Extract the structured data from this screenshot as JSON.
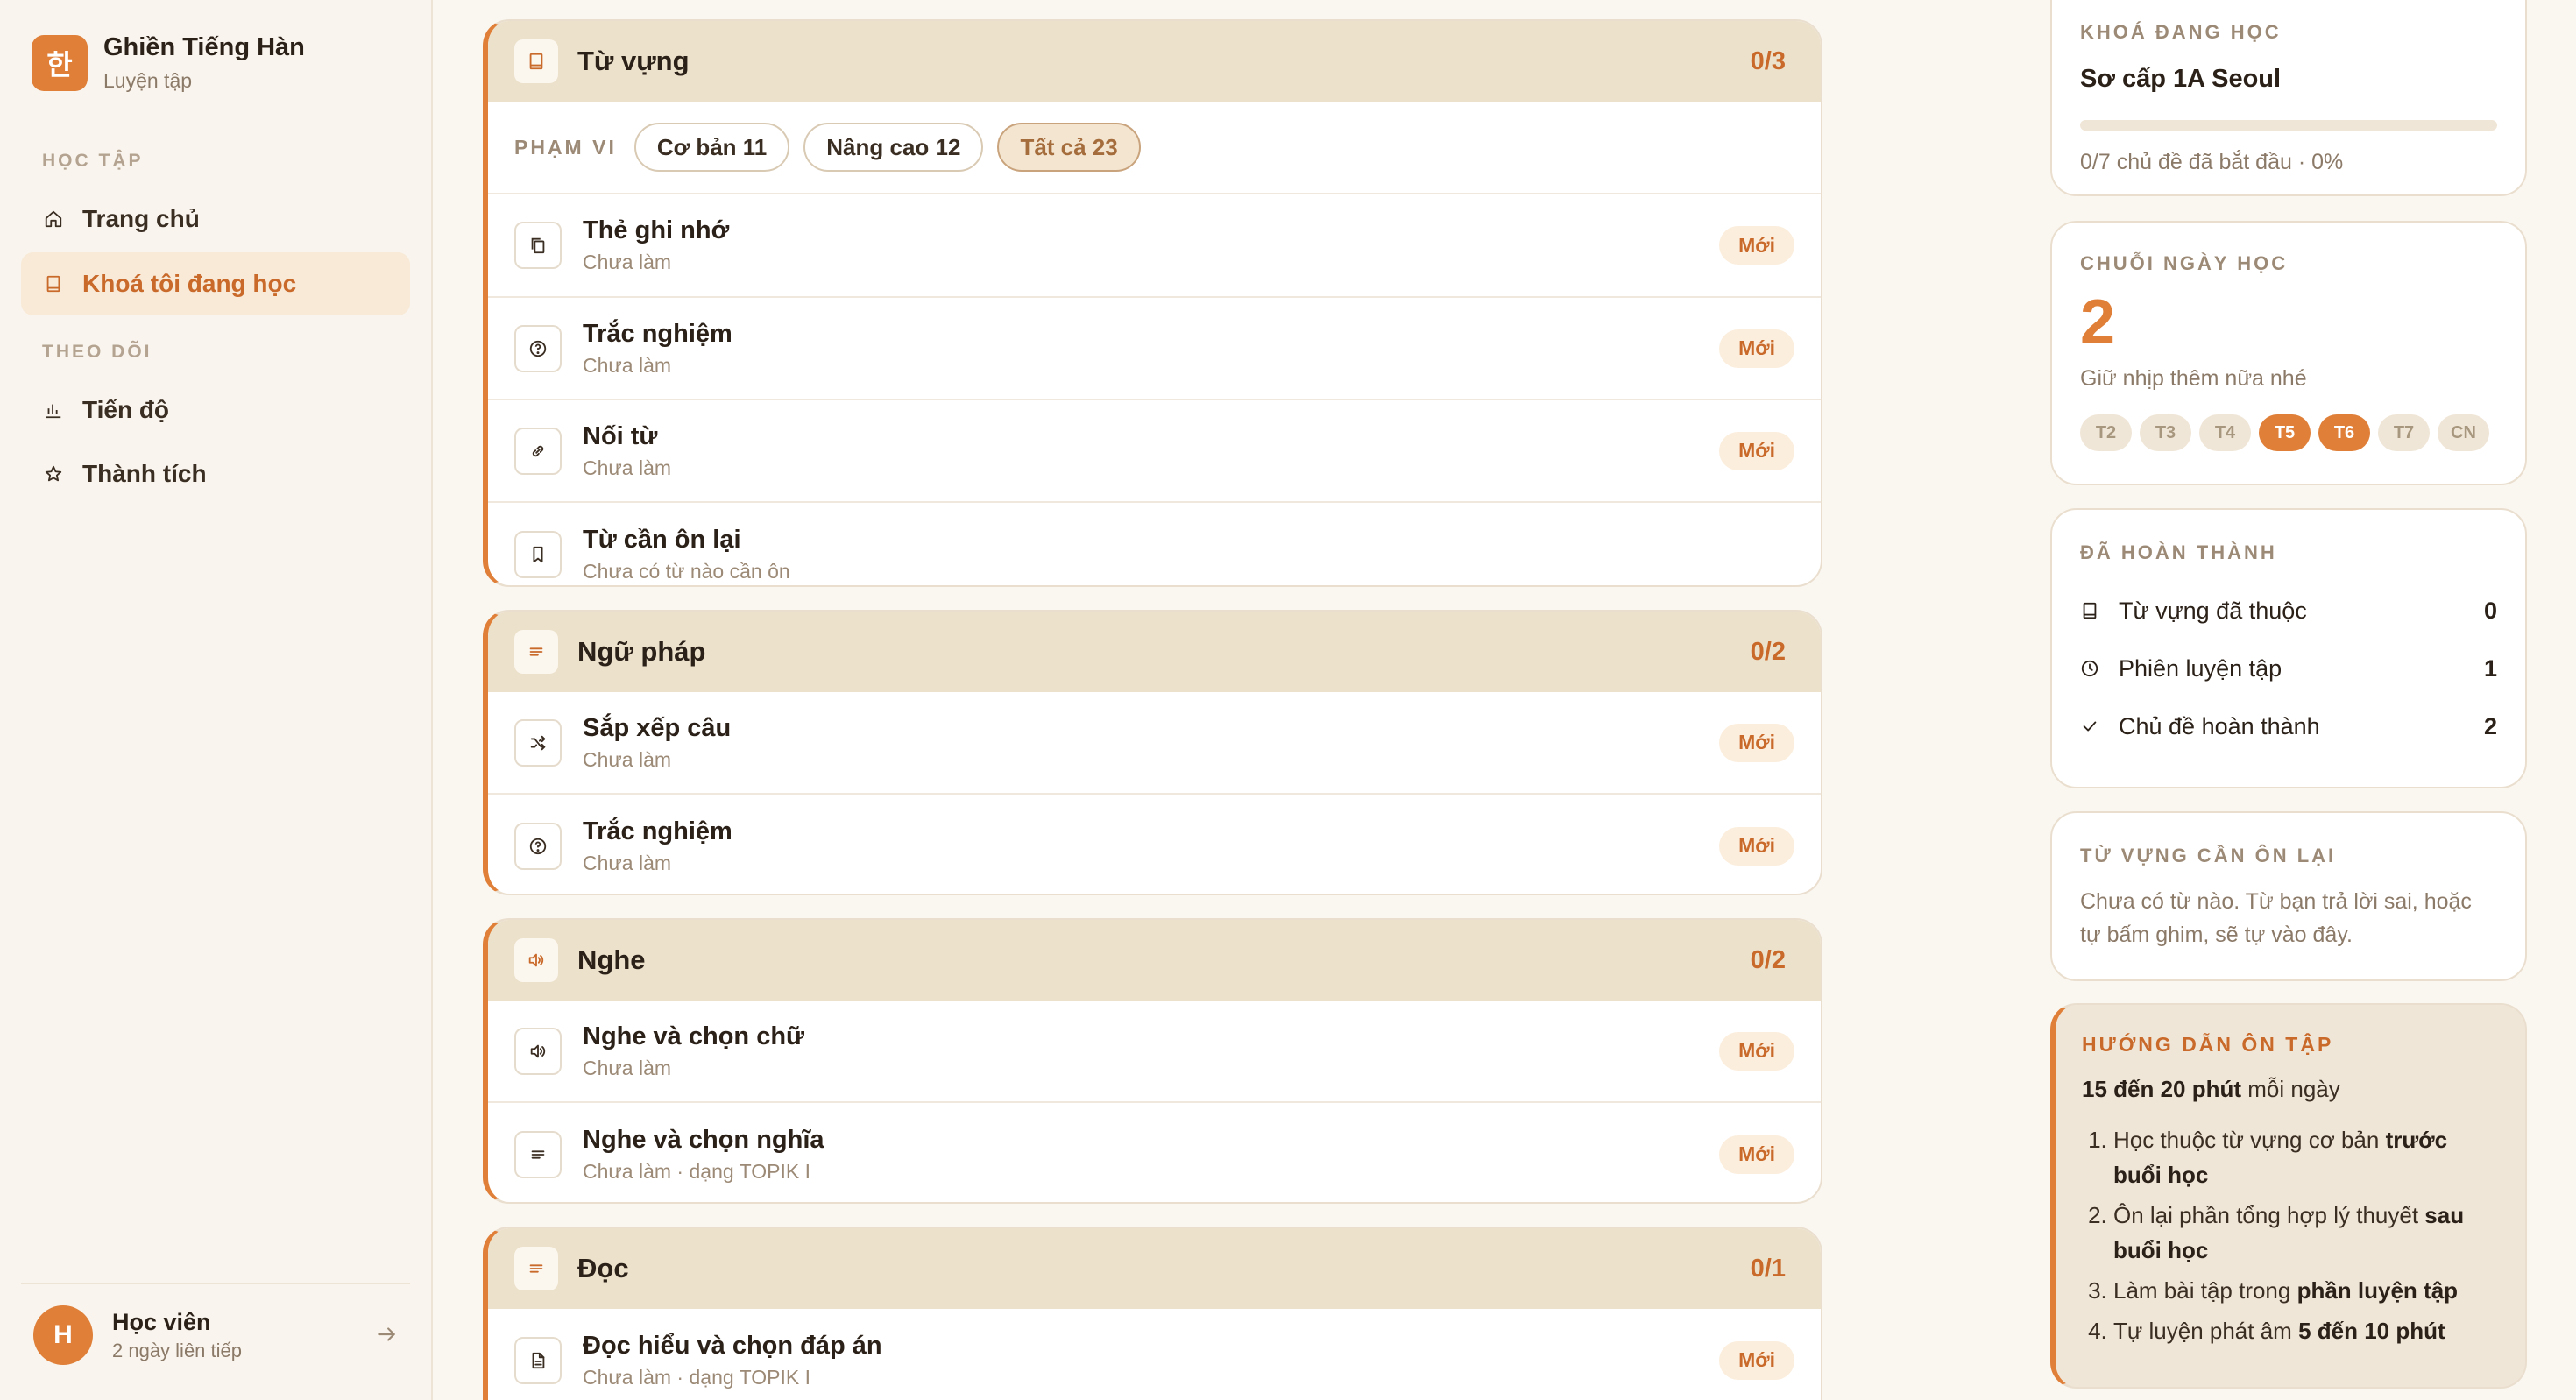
{
  "brand": {
    "logo_char": "한",
    "title": "Ghiền Tiếng Hàn",
    "subtitle": "Luyện tập"
  },
  "sidebar": {
    "section_learning": "HỌC TẬP",
    "section_tracking": "THEO DÕI",
    "items": [
      {
        "label": "Trang chủ",
        "icon": "home-icon"
      },
      {
        "label": "Khoá tôi đang học",
        "icon": "book-icon",
        "active": true
      },
      {
        "label": "Tiến độ",
        "icon": "chart-icon"
      },
      {
        "label": "Thành tích",
        "icon": "star-icon"
      }
    ]
  },
  "user": {
    "avatar_initial": "H",
    "name": "Học viên",
    "streak_text": "2 ngày liên tiếp"
  },
  "sections": {
    "vocab": {
      "title": "Từ vựng",
      "count": "0/3",
      "icon": "book-icon",
      "scope_label": "PHẠM VI",
      "chips": [
        "Cơ bản 11",
        "Nâng cao 12",
        "Tất cả 23"
      ],
      "active_chip": 2,
      "rows": [
        {
          "title": "Thẻ ghi nhớ",
          "sub": "Chưa làm",
          "badge": "Mới",
          "icon": "cards-icon"
        },
        {
          "title": "Trắc nghiệm",
          "sub": "Chưa làm",
          "badge": "Mới",
          "icon": "question-icon"
        },
        {
          "title": "Nối từ",
          "sub": "Chưa làm",
          "badge": "Mới",
          "icon": "link-icon"
        },
        {
          "title": "Từ cần ôn lại",
          "sub": "Chưa có từ nào cần ôn",
          "badge": "",
          "icon": "bookmark-icon"
        }
      ]
    },
    "grammar": {
      "title": "Ngữ pháp",
      "count": "0/2",
      "icon": "lines-icon",
      "rows": [
        {
          "title": "Sắp xếp câu",
          "sub": "Chưa làm",
          "badge": "Mới",
          "icon": "shuffle-icon"
        },
        {
          "title": "Trắc nghiệm",
          "sub": "Chưa làm",
          "badge": "Mới",
          "icon": "question-icon"
        }
      ]
    },
    "listening": {
      "title": "Nghe",
      "count": "0/2",
      "icon": "speaker-icon",
      "rows": [
        {
          "title": "Nghe và chọn chữ",
          "sub": "Chưa làm",
          "badge": "Mới",
          "icon": "speaker-icon"
        },
        {
          "title": "Nghe và chọn nghĩa",
          "sub": "Chưa làm · dạng TOPIK I",
          "badge": "Mới",
          "icon": "lines-icon"
        }
      ]
    },
    "reading": {
      "title": "Đọc",
      "count": "0/1",
      "icon": "lines-icon",
      "rows": [
        {
          "title": "Đọc hiểu và chọn đáp án",
          "sub": "Chưa làm · dạng TOPIK I",
          "badge": "Mới",
          "icon": "document-icon"
        }
      ]
    }
  },
  "current_course": {
    "label": "KHOÁ ĐANG HỌC",
    "name": "Sơ cấp 1A Seoul",
    "progress_fraction": 0,
    "progress_text": "0/7 chủ đề đã bắt đầu · 0%"
  },
  "streak": {
    "label": "CHUỖI NGÀY HỌC",
    "count": "2",
    "subtitle": "Giữ nhịp thêm nữa nhé",
    "days": [
      {
        "label": "T2",
        "active": false
      },
      {
        "label": "T3",
        "active": false
      },
      {
        "label": "T4",
        "active": false
      },
      {
        "label": "T5",
        "active": true
      },
      {
        "label": "T6",
        "active": true
      },
      {
        "label": "T7",
        "active": false
      },
      {
        "label": "CN",
        "active": false
      }
    ]
  },
  "completed": {
    "label": "ĐÃ HOÀN THÀNH",
    "stats": [
      {
        "label": "Từ vựng đã thuộc",
        "value": "0",
        "icon": "book-icon"
      },
      {
        "label": "Phiên luyện tập",
        "value": "1",
        "icon": "clock-icon"
      },
      {
        "label": "Chủ đề hoàn thành",
        "value": "2",
        "icon": "check-icon"
      }
    ]
  },
  "review": {
    "label": "TỪ VỰNG CẦN ÔN LẠI",
    "text": "Chưa có từ nào. Từ bạn trả lời sai, hoặc tự bấm ghim, sẽ tự vào đây."
  },
  "guide": {
    "label": "HƯỚNG DẪN ÔN TẬP",
    "intro_bold": "15 đến 20 phút",
    "intro_rest": " mỗi ngày",
    "steps": [
      {
        "text": "Học thuộc từ vựng cơ bản ",
        "bold": "trước buổi học"
      },
      {
        "text": "Ôn lại phần tổng hợp lý thuyết ",
        "bold": "sau buổi học"
      },
      {
        "text": "Làm bài tập trong ",
        "bold": "phần luyện tập"
      },
      {
        "text": "Tự luyện phát âm ",
        "bold": "5 đến 10 phút"
      }
    ]
  },
  "colors": {
    "accent": "#df7f38",
    "section_header": "#ece1cb",
    "background": "#faf6f0"
  }
}
